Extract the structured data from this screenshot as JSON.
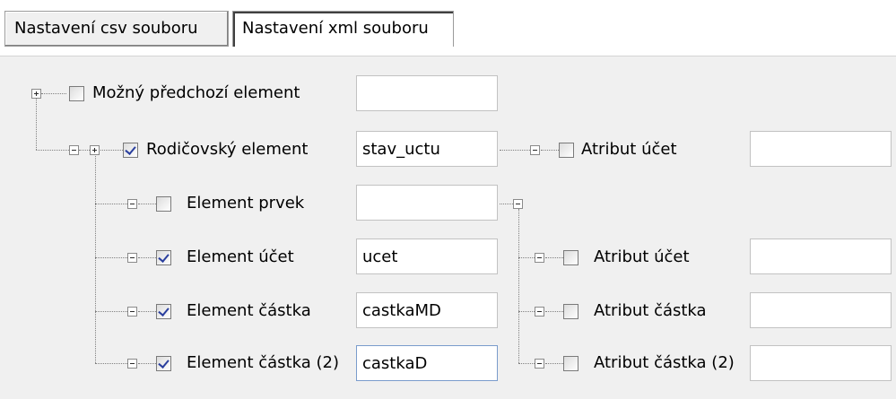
{
  "tabs": [
    {
      "label": "Nastavení csv souboru",
      "active": false
    },
    {
      "label": "Nastavení xml souboru",
      "active": true
    }
  ],
  "tree": {
    "predchozi": {
      "label": "Možný předchozí element",
      "checked": false,
      "value": ""
    },
    "rodic": {
      "label": "Rodičovský element",
      "checked": true,
      "value": "stav_uctu"
    },
    "rodic_atribut": {
      "label": "Atribut účet",
      "checked": false,
      "value": ""
    },
    "prvek": {
      "label": "Element prvek",
      "checked": false,
      "value": ""
    },
    "ucet": {
      "label": "Element účet",
      "checked": true,
      "value": "ucet"
    },
    "castka": {
      "label": "Element částka",
      "checked": true,
      "value": "castkaMD"
    },
    "castka2": {
      "label": "Element částka (2)",
      "checked": true,
      "value": "castkaD"
    },
    "atr_ucet": {
      "label": "Atribut účet",
      "checked": false,
      "value": ""
    },
    "atr_castka": {
      "label": "Atribut částka",
      "checked": false,
      "value": ""
    },
    "atr_castka2": {
      "label": "Atribut částka (2)",
      "checked": false,
      "value": ""
    }
  },
  "icons": {
    "expand": "plus-box-icon",
    "collapse": "minus-box-icon",
    "checkbox_checked_color": "#2a3f9e"
  }
}
